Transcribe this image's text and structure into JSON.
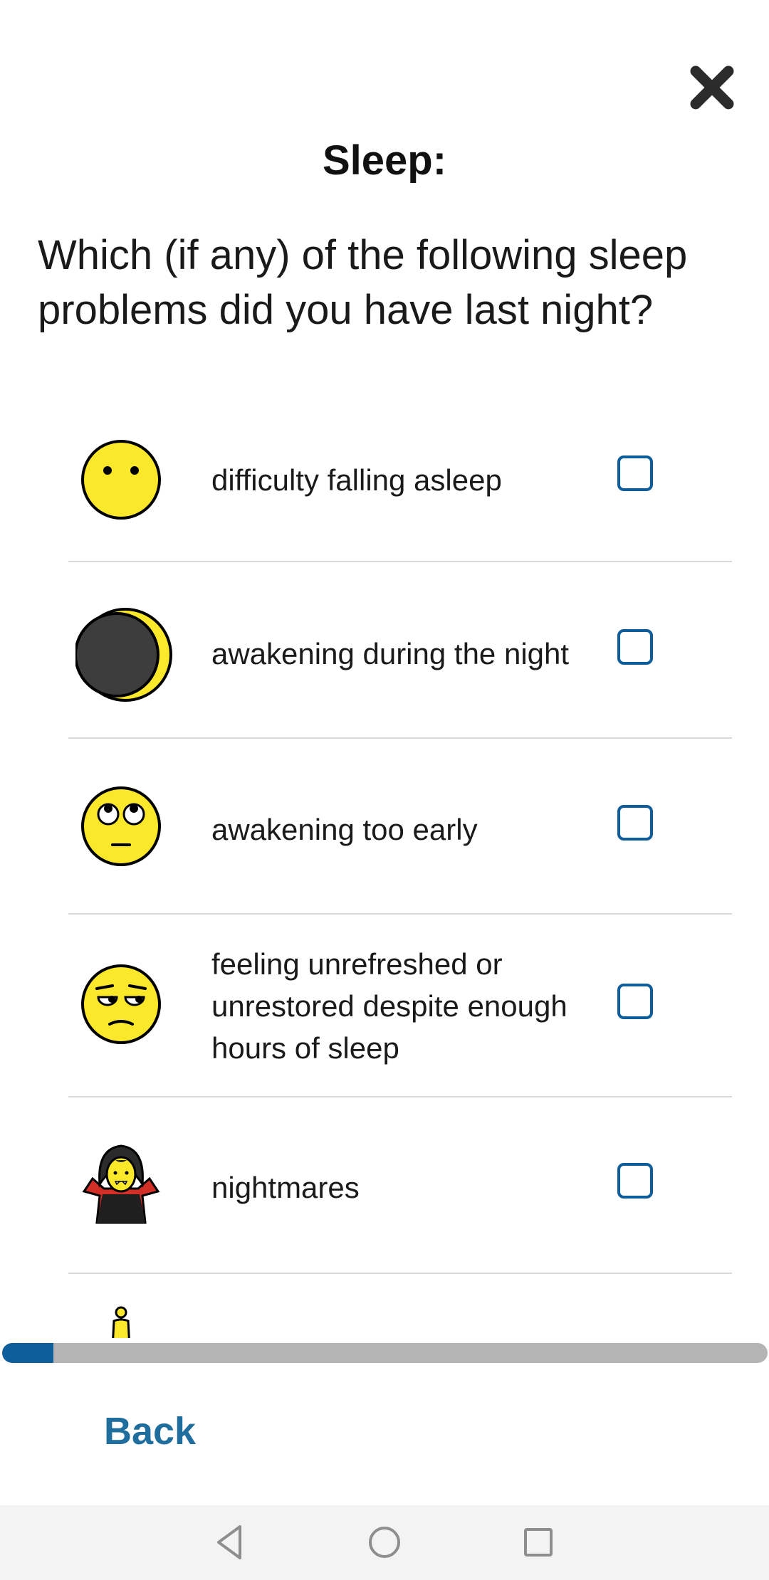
{
  "header": {
    "close_icon": "close-x-icon",
    "title": "Sleep:"
  },
  "question": "Which (if any) of the following sleep problems did you have last night?",
  "options": [
    {
      "icon": "neutral-face-icon",
      "label": "difficulty falling asleep",
      "checked": false
    },
    {
      "icon": "crescent-moon-icon",
      "label": "awakening during the night",
      "checked": false
    },
    {
      "icon": "rolling-eyes-face-icon",
      "label": "awakening too early",
      "checked": false
    },
    {
      "icon": "unamused-face-icon",
      "label": "feeling unrefreshed or unrestored despite enough hours of sleep",
      "checked": false
    },
    {
      "icon": "vampire-icon",
      "label": "nightmares",
      "checked": false
    },
    {
      "icon": "person-icon",
      "label": "",
      "checked": false
    }
  ],
  "progress": {
    "fraction": 0.067
  },
  "footer": {
    "back_label": "Back"
  },
  "system_nav": {
    "back_icon": "nav-back-triangle-icon",
    "home_icon": "nav-home-circle-icon",
    "recents_icon": "nav-recents-square-icon"
  },
  "colors": {
    "accent": "#0f5e9c",
    "link": "#1f6e9e",
    "progress_track": "#b4b4b4",
    "divider": "#d9d9d9"
  }
}
